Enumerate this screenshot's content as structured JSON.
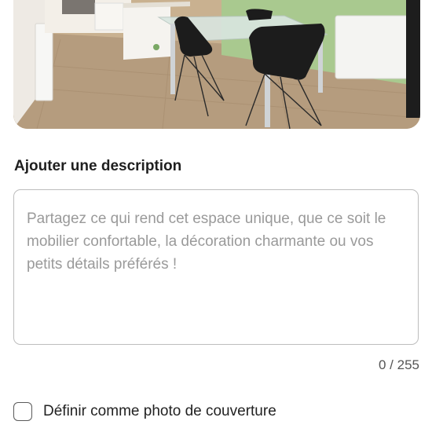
{
  "photo": {
    "alt_icon": "room-photo"
  },
  "description": {
    "heading": "Ajouter une description",
    "placeholder": "Partagez ce qui rend cet espace unique, que ce soit le mobilier confortable, la décoration charmante ou vos petits détails préférés !",
    "value": "",
    "counter": "0 / 255"
  },
  "cover": {
    "label": "Définir comme photo de couverture",
    "checked": false
  },
  "colors": {
    "wall_green": "#a9c98f",
    "floor_wood": "#b59c7e",
    "chair_black": "#1c1c1c",
    "border_gray": "#bdbdbd"
  }
}
